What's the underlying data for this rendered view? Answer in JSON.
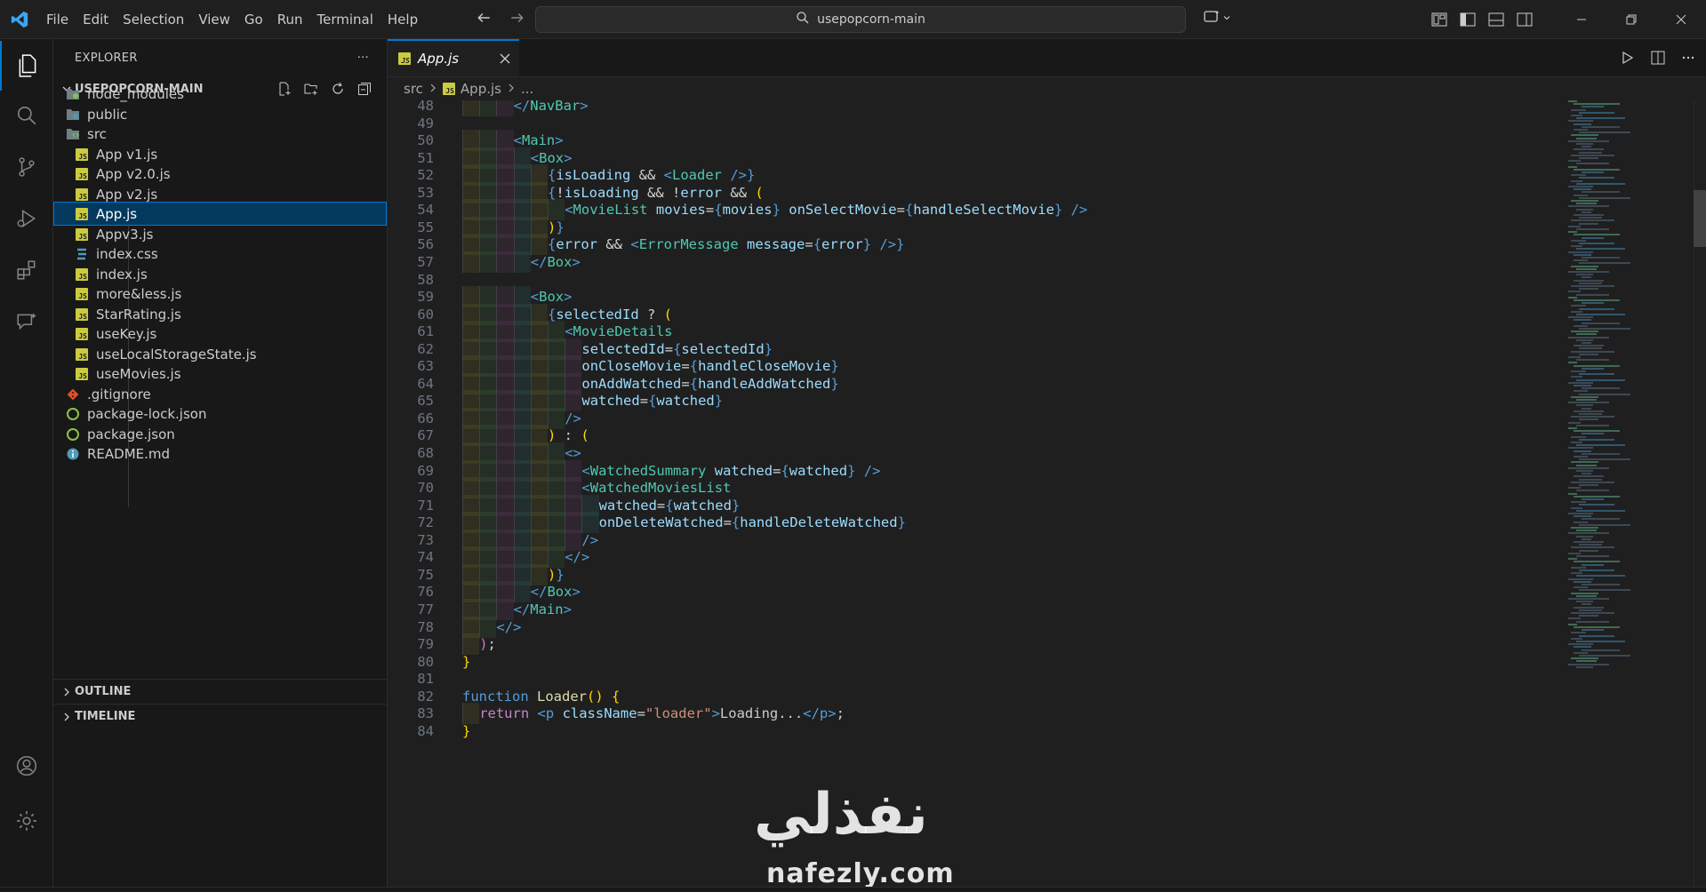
{
  "menu": [
    "File",
    "Edit",
    "Selection",
    "View",
    "Go",
    "Run",
    "Terminal",
    "Help"
  ],
  "search": {
    "text": "usepopcorn-main"
  },
  "sidebar": {
    "title": "EXPLORER",
    "more": "···",
    "project": "USEPOPCORN-MAIN",
    "items": [
      {
        "label": "node_modules",
        "icon": "folder-node-icon"
      },
      {
        "label": "public",
        "icon": "folder-public-icon"
      },
      {
        "label": "src",
        "icon": "folder-src-icon"
      },
      {
        "label": "App v1.js",
        "icon": "js-file-icon"
      },
      {
        "label": "App v2.0.js",
        "icon": "js-file-icon"
      },
      {
        "label": "App v2.js",
        "icon": "js-file-icon"
      },
      {
        "label": "App.js",
        "icon": "js-file-icon"
      },
      {
        "label": "Appv3.js",
        "icon": "js-file-icon"
      },
      {
        "label": "index.css",
        "icon": "css-file-icon"
      },
      {
        "label": "index.js",
        "icon": "js-file-icon"
      },
      {
        "label": "more&less.js",
        "icon": "js-file-icon"
      },
      {
        "label": "StarRating.js",
        "icon": "js-file-icon"
      },
      {
        "label": "useKey.js",
        "icon": "js-file-icon"
      },
      {
        "label": "useLocalStorageState.js",
        "icon": "js-file-icon"
      },
      {
        "label": "useMovies.js",
        "icon": "js-file-icon"
      },
      {
        "label": ".gitignore",
        "icon": "git-file-icon"
      },
      {
        "label": "package-lock.json",
        "icon": "json-file-icon"
      },
      {
        "label": "package.json",
        "icon": "json-file-icon"
      },
      {
        "label": "README.md",
        "icon": "info-file-icon"
      }
    ],
    "outline": "OUTLINE",
    "timeline": "TIMELINE"
  },
  "tab": {
    "label": "App.js",
    "js_badge": "JS"
  },
  "breadcrumb": {
    "folder": "src",
    "file": "App.js",
    "more": "..."
  },
  "code": {
    "line_numbers": [
      "48",
      "49",
      "50",
      "51",
      "52",
      "53",
      "54",
      "55",
      "56",
      "57",
      "58",
      "59",
      "60",
      "61",
      "62",
      "63",
      "64",
      "65",
      "66",
      "67",
      "68",
      "69",
      "70",
      "71",
      "72",
      "73",
      "74",
      "75",
      "76",
      "77",
      "78",
      "79",
      "80",
      "81",
      "82",
      "83",
      "84"
    ]
  },
  "colors": {
    "accent": "#0078d4",
    "selection": "#04395e",
    "js": "#cbcb41"
  },
  "watermark": {
    "arabic": "نفذلي",
    "latin": "nafezly.com"
  }
}
